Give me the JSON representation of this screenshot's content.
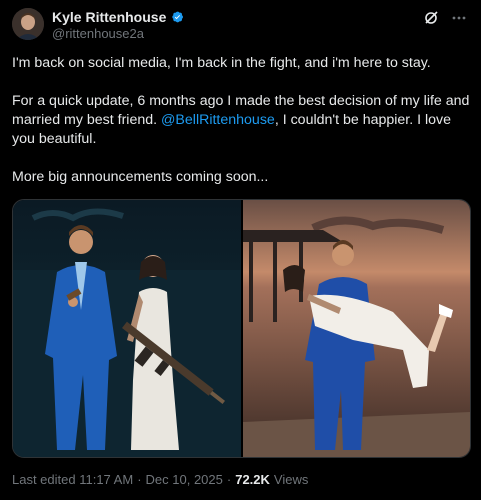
{
  "author": {
    "name": "Kyle Rittenhouse",
    "handle": "@rittenhouse2a",
    "verified_icon": "verified-badge-icon",
    "accent": "#1d9bf0"
  },
  "top_icons": [
    "grok-icon",
    "more-icon"
  ],
  "post": {
    "line1": "I'm back on social media, I'm back in the fight, and i'm here to stay.",
    "p2_before": "For a quick update, 6 months ago I made the best decision of my life and married my best friend. ",
    "p2_mention": "@BellRittenhouse",
    "p2_after": ", I couldn't be happier. I love you beautiful.",
    "line3": "More big announcements coming soon..."
  },
  "media": {
    "count": 2,
    "photos": [
      "wedding-photo-left",
      "wedding-photo-right"
    ]
  },
  "footer": {
    "edited": "Last edited 11:17 AM",
    "sep1": "·",
    "date": "Dec 10, 2025",
    "sep2": "·",
    "views_count": "72.2K",
    "views_label": "Views"
  }
}
